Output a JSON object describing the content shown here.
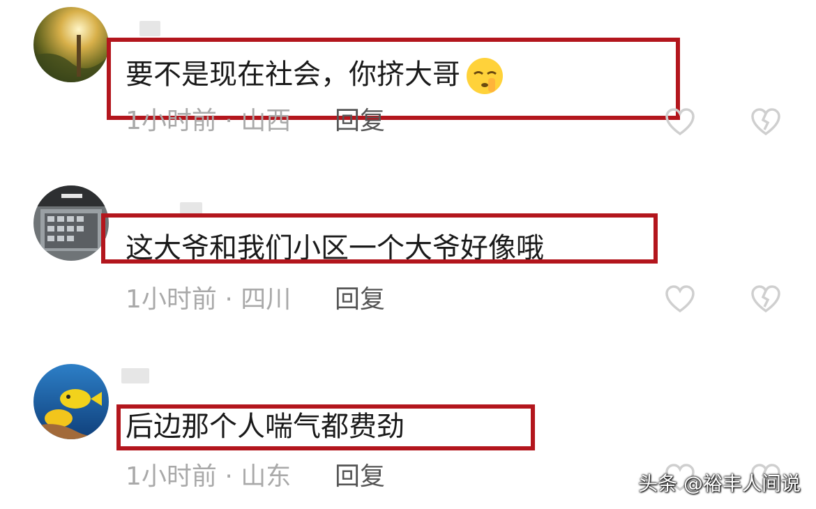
{
  "comments": [
    {
      "text": "要不是现在社会，你挤大哥",
      "emoji": "shushing-face-emoji",
      "meta": "1小时前 · 山西",
      "reply": "回复"
    },
    {
      "text": "这大爷和我们小区一个大爷好像哦",
      "meta": "1小时前 · 四川",
      "reply": "回复"
    },
    {
      "text": "后边那个人喘气都费劲",
      "meta": "1小时前 · 山东",
      "reply": "回复"
    }
  ],
  "icons": {
    "like": "heart-outline-icon",
    "dislike": "broken-heart-icon"
  },
  "colors": {
    "highlight": "#b3161d",
    "meta_text": "#a9a9a9",
    "reply_text": "#555555"
  },
  "watermark": "头条 @裕丰人间说"
}
